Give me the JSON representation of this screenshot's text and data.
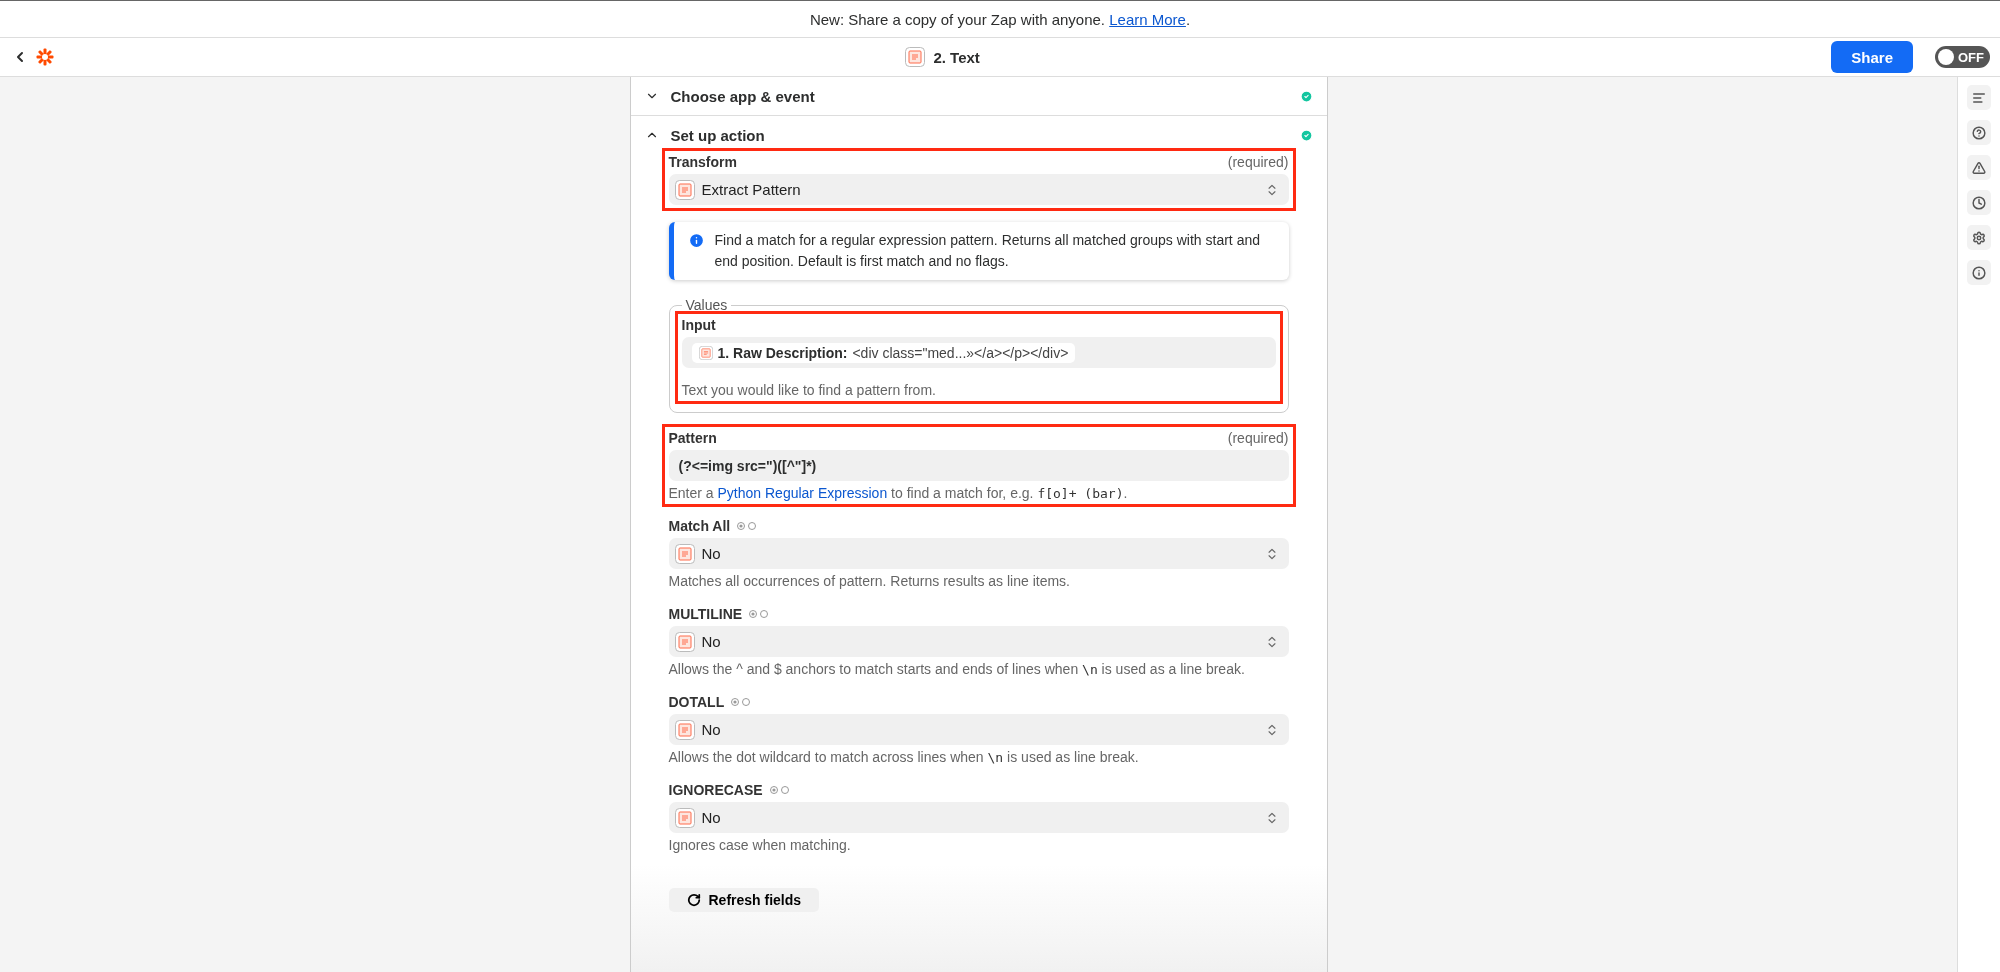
{
  "banner": {
    "text": "New: Share a copy of your Zap with anyone.",
    "link": "Learn More",
    "end": "."
  },
  "header": {
    "title": "2. Text",
    "share": "Share",
    "toggle": {
      "label": "OFF",
      "on": false
    }
  },
  "sections": [
    {
      "title": "Choose app & event",
      "expanded": false,
      "complete": true
    },
    {
      "title": "Set up action",
      "expanded": true,
      "complete": true
    }
  ],
  "fields": [
    {
      "kind": "select",
      "label": "Transform",
      "required": "(required)",
      "value": "Extract Pattern",
      "highlighted": true
    },
    {
      "kind": "info",
      "text": "Find a match for a regular expression pattern. Returns all matched groups with start and end position. Default is first match and no flags."
    },
    {
      "kind": "group",
      "legend": "Values",
      "children": [
        {
          "kind": "pill",
          "label": "Input",
          "pill_label": "1. Raw Description:",
          "pill_value": "<div class=\"med...»</a></p></div>",
          "help": [
            {
              "kind": "text",
              "text": "Text you would like to find a pattern from."
            }
          ],
          "highlighted": true
        }
      ]
    },
    {
      "kind": "text",
      "label": "Pattern",
      "required": "(required)",
      "value": "(?<=img src=\")([^\"]*)",
      "highlighted": true,
      "help": [
        {
          "kind": "text",
          "text": "Enter a "
        },
        {
          "kind": "link",
          "text": "Python Regular Expression"
        },
        {
          "kind": "text",
          "text": " to find a match for, e.g. "
        },
        {
          "kind": "code",
          "text": "f[o]+ (bar)"
        },
        {
          "kind": "text",
          "text": "."
        }
      ]
    },
    {
      "kind": "select",
      "label": "Match All",
      "mapping": true,
      "value": "No",
      "highlighted": false,
      "help": [
        {
          "kind": "text",
          "text": "Matches all occurrences of pattern. Returns results as line items."
        }
      ]
    },
    {
      "kind": "select",
      "label": "MULTILINE",
      "mapping": true,
      "value": "No",
      "highlighted": false,
      "help": [
        {
          "kind": "text",
          "text": "Allows the ^ and $ anchors to match starts and ends of lines when "
        },
        {
          "kind": "code",
          "text": "\\n"
        },
        {
          "kind": "text",
          "text": " is used as a line break."
        }
      ]
    },
    {
      "kind": "select",
      "label": "DOTALL",
      "mapping": true,
      "value": "No",
      "highlighted": false,
      "help": [
        {
          "kind": "text",
          "text": "Allows the dot wildcard to match across lines when "
        },
        {
          "kind": "code",
          "text": "\\n"
        },
        {
          "kind": "text",
          "text": " is used as line break."
        }
      ]
    },
    {
      "kind": "select",
      "label": "IGNORECASE",
      "mapping": true,
      "value": "No",
      "highlighted": false,
      "help": [
        {
          "kind": "text",
          "text": "Ignores case when matching."
        }
      ]
    }
  ],
  "refresh": "Refresh fields"
}
